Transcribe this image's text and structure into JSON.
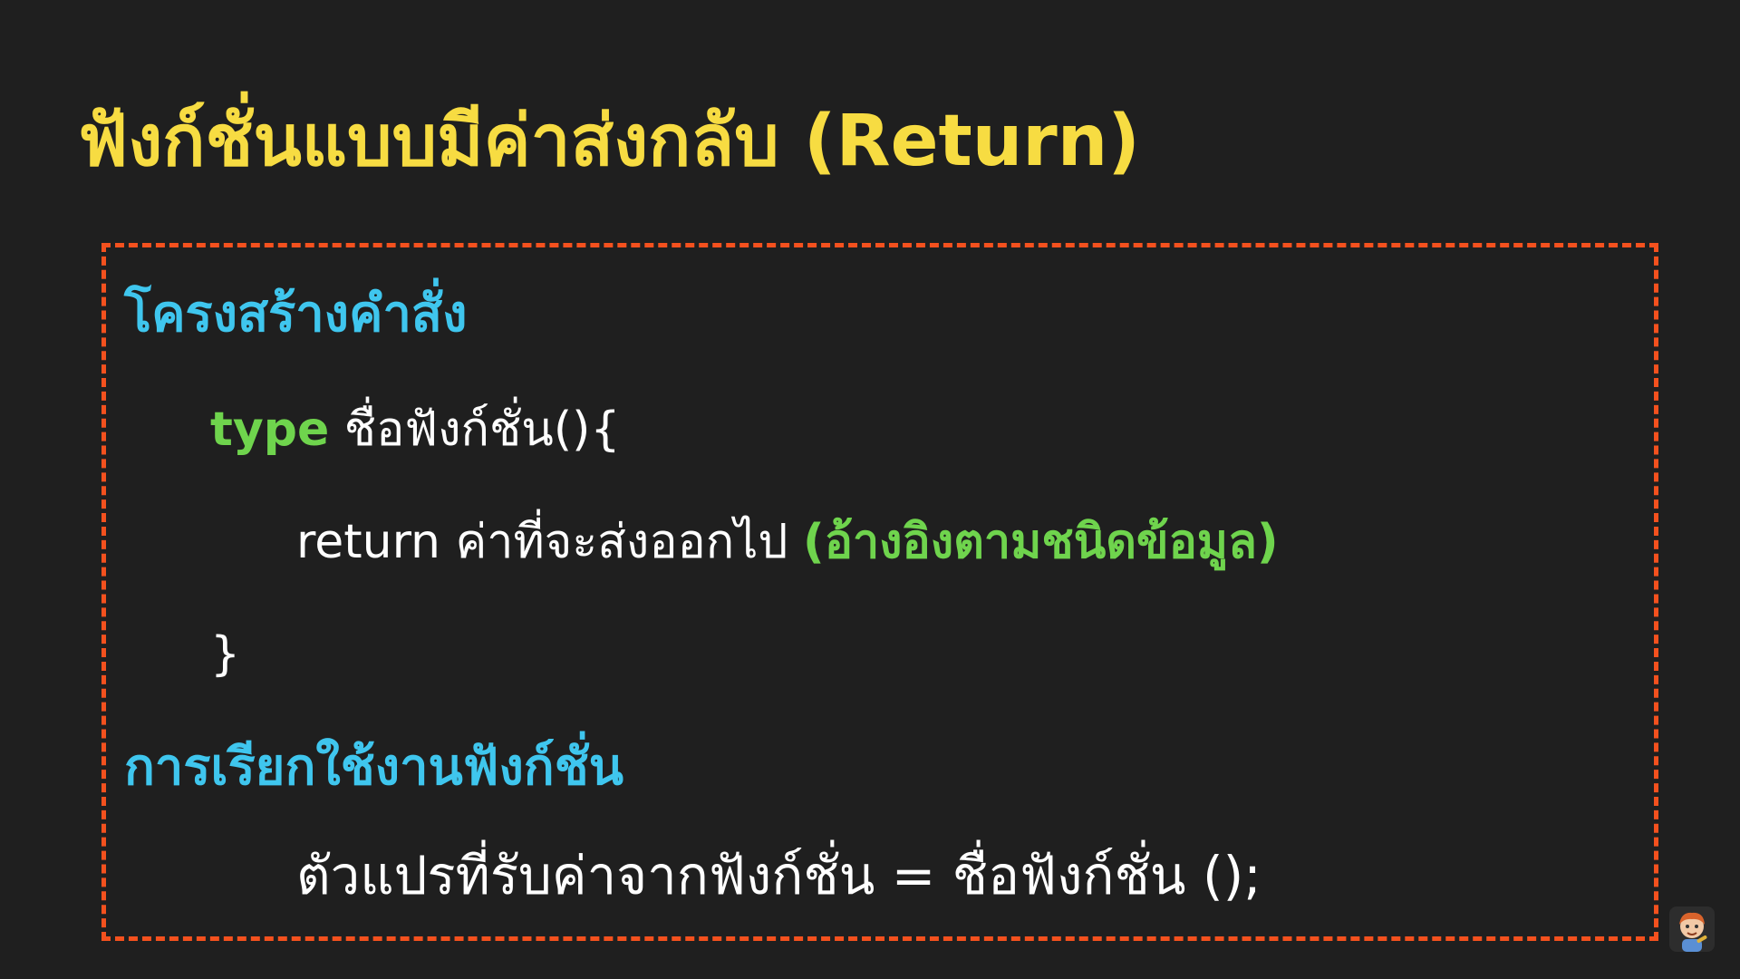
{
  "slide": {
    "title": "ฟังก์ชั่นแบบมีค่าส่งกลับ (Return)",
    "structure_heading": "โครงสร้างคำสั่ง",
    "code": {
      "line1_keyword": "type",
      "line1_rest": " ชื่อฟังก์ชั่น(){",
      "line2_main": "return ค่าที่จะส่งออกไป ",
      "line2_note": "(อ้างอิงตามชนิดข้อมูล)",
      "line3": "}"
    },
    "usage_heading": "การเรียกใช้งานฟังก์ชั่น",
    "usage_code": "ตัวแปรที่รับค่าจากฟังก์ชั่น = ชื่อฟังก์ชั่น ();"
  },
  "colors": {
    "background": "#1f1f1f",
    "title": "#f7dc42",
    "heading": "#3fc6ee",
    "keyword": "#6fd44d",
    "border": "#f4511e",
    "text": "#ffffff"
  },
  "icons": {
    "avatar": "presenter-avatar-icon"
  }
}
